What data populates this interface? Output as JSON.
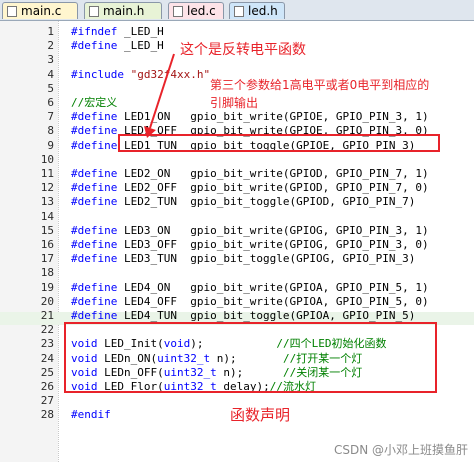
{
  "tabs": [
    {
      "label": "main.c",
      "color": "#fff6cf"
    },
    {
      "label": "main.h",
      "color": "#e8f3d6"
    },
    {
      "label": "led.c",
      "color": "#fde3e8"
    },
    {
      "label": "led.h",
      "color": "#cfe6f9"
    }
  ],
  "lines": [
    {
      "n": "1",
      "t": "#ifndef _LED_H"
    },
    {
      "n": "2",
      "t": "#define _LED_H"
    },
    {
      "n": "3",
      "t": ""
    },
    {
      "n": "4",
      "t": "#include \"gd32f4xx.h\""
    },
    {
      "n": "5",
      "t": ""
    },
    {
      "n": "6",
      "t": "//宏定义"
    },
    {
      "n": "7",
      "t": "#define LED1_ON   gpio_bit_write(GPIOE, GPIO_PIN_3, 1)"
    },
    {
      "n": "8",
      "t": "#define LED1_OFF  gpio_bit_write(GPIOE, GPIO_PIN_3, 0)"
    },
    {
      "n": "9",
      "t": "#define LED1_TUN  gpio_bit_toggle(GPIOE, GPIO_PIN_3)"
    },
    {
      "n": "10",
      "t": ""
    },
    {
      "n": "11",
      "t": "#define LED2_ON   gpio_bit_write(GPIOD, GPIO_PIN_7, 1)"
    },
    {
      "n": "12",
      "t": "#define LED2_OFF  gpio_bit_write(GPIOD, GPIO_PIN_7, 0)"
    },
    {
      "n": "13",
      "t": "#define LED2_TUN  gpio_bit_toggle(GPIOD, GPIO_PIN_7)"
    },
    {
      "n": "14",
      "t": ""
    },
    {
      "n": "15",
      "t": "#define LED3_ON   gpio_bit_write(GPIOG, GPIO_PIN_3, 1)"
    },
    {
      "n": "16",
      "t": "#define LED3_OFF  gpio_bit_write(GPIOG, GPIO_PIN_3, 0)"
    },
    {
      "n": "17",
      "t": "#define LED3_TUN  gpio_bit_toggle(GPIOG, GPIO_PIN_3)"
    },
    {
      "n": "18",
      "t": ""
    },
    {
      "n": "19",
      "t": "#define LED4_ON   gpio_bit_write(GPIOA, GPIO_PIN_5, 1)"
    },
    {
      "n": "20",
      "t": "#define LED4_OFF  gpio_bit_write(GPIOA, GPIO_PIN_5, 0)"
    },
    {
      "n": "21",
      "t": "#define LED4_TUN  gpio_bit_toggle(GPIOA, GPIO_PIN_5)"
    },
    {
      "n": "22",
      "t": ""
    },
    {
      "n": "23",
      "t": "void LED_Init(void);           //四个LED初始化函数"
    },
    {
      "n": "24",
      "t": "void LEDn_ON(uint32_t n);       //打开某一个灯"
    },
    {
      "n": "25",
      "t": "void LEDn_OFF(uint32_t n);      //关闭某一个灯"
    },
    {
      "n": "26",
      "t": "void LED_Flor(uint32_t delay);//流水灯"
    },
    {
      "n": "27",
      "t": ""
    },
    {
      "n": "28",
      "t": "#endif"
    }
  ],
  "annotations": {
    "toggle": "这个是反转电平函数",
    "third_param_1": "第三个参数给1高电平或者0电平到相应的",
    "third_param_2": "引脚输出",
    "declarations": "函数声明"
  },
  "watermark": "CSDN @小邓上班摸鱼肝",
  "colors": {
    "annotation": "#e8232a",
    "keyword": "#0000ff",
    "comment": "#008000",
    "string": "#a31515"
  }
}
